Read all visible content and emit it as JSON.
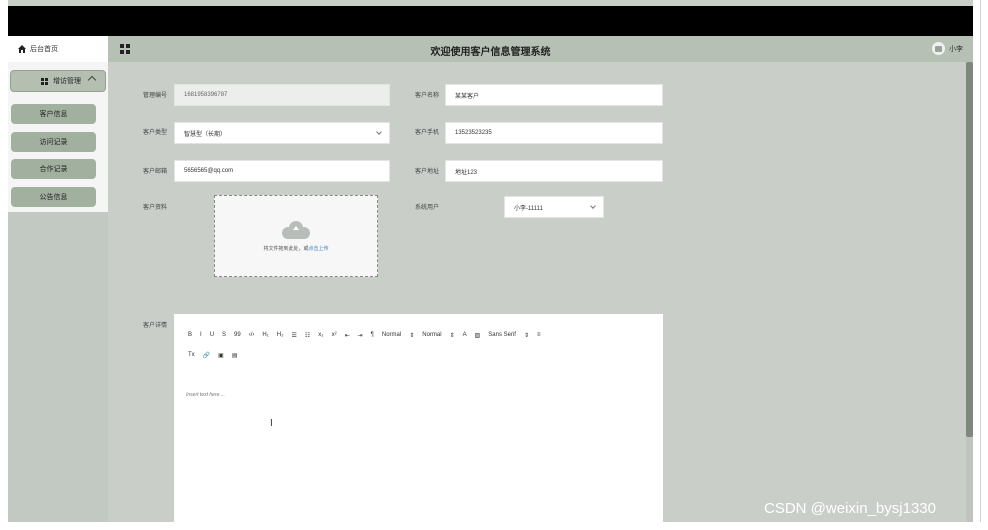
{
  "header": {
    "home_tab": "后台首页",
    "title": "欢迎使用客户信息管理系统",
    "username": "小李"
  },
  "sidebar": {
    "group_label": "增访管理",
    "items": [
      {
        "label": "客户信息"
      },
      {
        "label": "访问记录"
      },
      {
        "label": "合作记录"
      },
      {
        "label": "公告信息"
      }
    ]
  },
  "form": {
    "manage_no_label": "管理编号",
    "manage_no_value": "1681958396787",
    "customer_name_label": "客户名称",
    "customer_name_value": "某某客户",
    "customer_type_label": "客户类型",
    "customer_type_value": "智慧型（长期）",
    "customer_phone_label": "客户手机",
    "customer_phone_value": "13523523235",
    "customer_email_label": "客户邮箱",
    "customer_email_value": "5656565@qq.com",
    "customer_address_label": "客户地址",
    "customer_address_value": "地址123",
    "customer_file_label": "客户资料",
    "system_user_label": "系统用户",
    "system_user_value": "小李-11111",
    "customer_detail_label": "客户详情"
  },
  "upload": {
    "text": "将文件拖到此处，或",
    "link": "点击上传"
  },
  "editor": {
    "toolbar_row1": [
      "B",
      "I",
      "U",
      "S",
      "99",
      "‹/›",
      "H₁",
      "H₂",
      "☰",
      "☷",
      "x₂",
      "x²",
      "⇤",
      "⇥",
      "¶",
      "Normal",
      "⇕",
      "Normal",
      "⇕",
      "A",
      "▨",
      "Sans Serif",
      "⇕",
      "≡"
    ],
    "toolbar_row2": [
      "Tx",
      "🔗",
      "▣",
      "▤"
    ],
    "placeholder": "Insert text here ..."
  },
  "watermark": "CSDN @weixin_bysj1330"
}
